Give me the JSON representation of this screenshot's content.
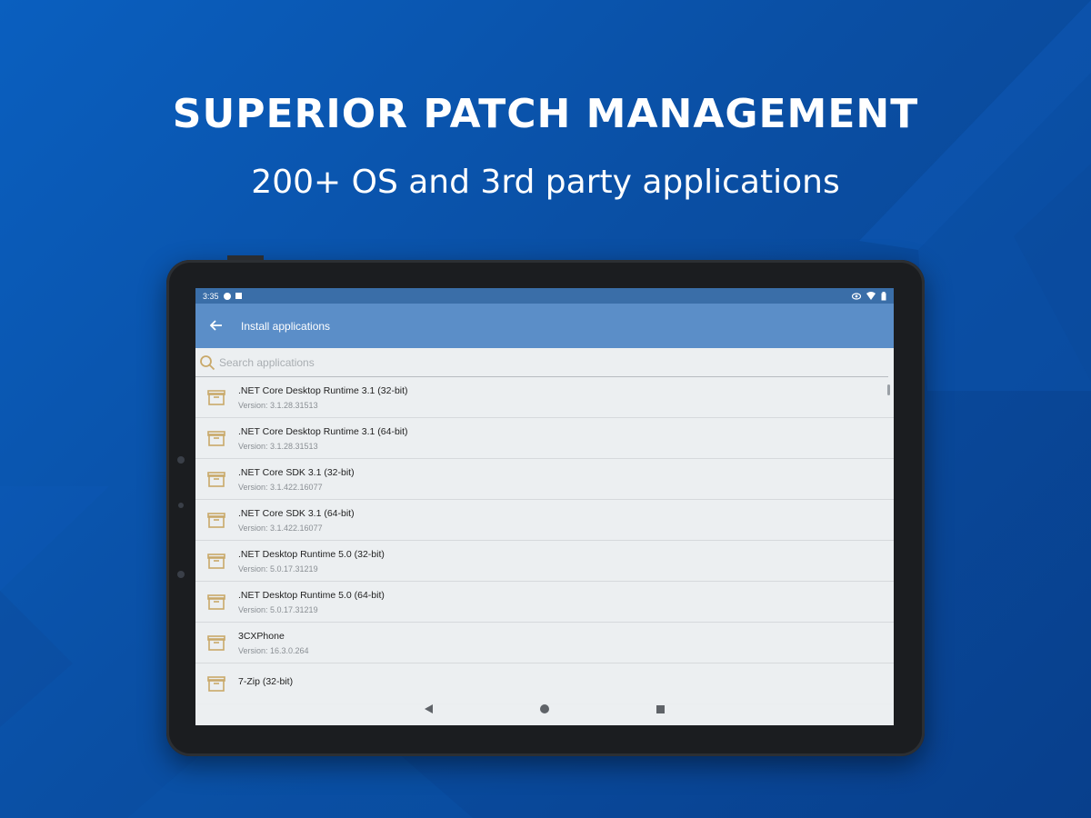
{
  "promo": {
    "headline": "SUPERIOR PATCH MANAGEMENT",
    "subline": "200+ OS and 3rd party applications"
  },
  "statusbar": {
    "time": "3:35",
    "left_icons": [
      "settings-icon",
      "notification-icon"
    ],
    "right_icons": [
      "eye-icon",
      "wifi-icon",
      "battery-icon"
    ]
  },
  "appbar": {
    "back_icon": "arrow-back-icon",
    "title": "Install applications"
  },
  "search": {
    "icon": "search-icon",
    "placeholder": "Search applications"
  },
  "apps": [
    {
      "name": ".NET Core Desktop Runtime 3.1 (32-bit)",
      "version": "Version: 3.1.28.31513"
    },
    {
      "name": ".NET Core Desktop Runtime 3.1 (64-bit)",
      "version": "Version: 3.1.28.31513"
    },
    {
      "name": ".NET Core SDK 3.1 (32-bit)",
      "version": "Version: 3.1.422.16077"
    },
    {
      "name": ".NET Core SDK 3.1 (64-bit)",
      "version": "Version: 3.1.422.16077"
    },
    {
      "name": ".NET Desktop Runtime 5.0 (32-bit)",
      "version": "Version: 5.0.17.31219"
    },
    {
      "name": ".NET Desktop Runtime 5.0 (64-bit)",
      "version": "Version: 5.0.17.31219"
    },
    {
      "name": "3CXPhone",
      "version": "Version: 16.3.0.264"
    },
    {
      "name": "7-Zip (32-bit)",
      "version": ""
    }
  ],
  "navbar": {
    "icons": [
      "nav-back-icon",
      "nav-home-icon",
      "nav-recents-icon"
    ]
  },
  "colors": {
    "background": "#0a4fa4",
    "appbar": "#5b8ec8",
    "statusbar": "#3a6ea8",
    "package_icon": "#c9a96a"
  }
}
